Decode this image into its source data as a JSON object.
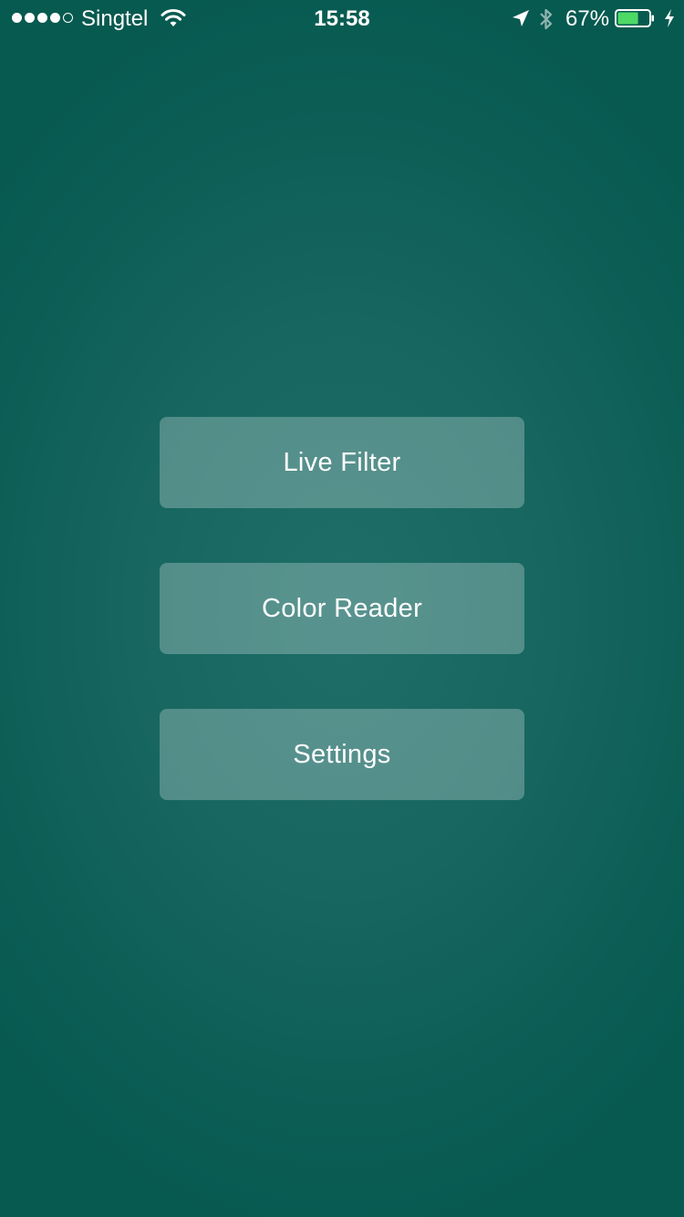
{
  "status_bar": {
    "carrier": "Singtel",
    "signal_bars_filled": 4,
    "signal_bars_total": 5,
    "time": "15:58",
    "battery_percent": "67%",
    "battery_level": 0.67,
    "battery_fill_color": "#4cd964",
    "icons": [
      "wifi-icon",
      "location-arrow-icon",
      "bluetooth-icon",
      "battery-icon",
      "charging-bolt-icon"
    ]
  },
  "menu": {
    "items": [
      {
        "label": "Live Filter"
      },
      {
        "label": "Color Reader"
      },
      {
        "label": "Settings"
      }
    ]
  },
  "colors": {
    "background_center": "#1f6e68",
    "background_edge": "#075a50",
    "button_fill": "rgba(255,255,255,0.26)",
    "text": "#ffffff"
  }
}
